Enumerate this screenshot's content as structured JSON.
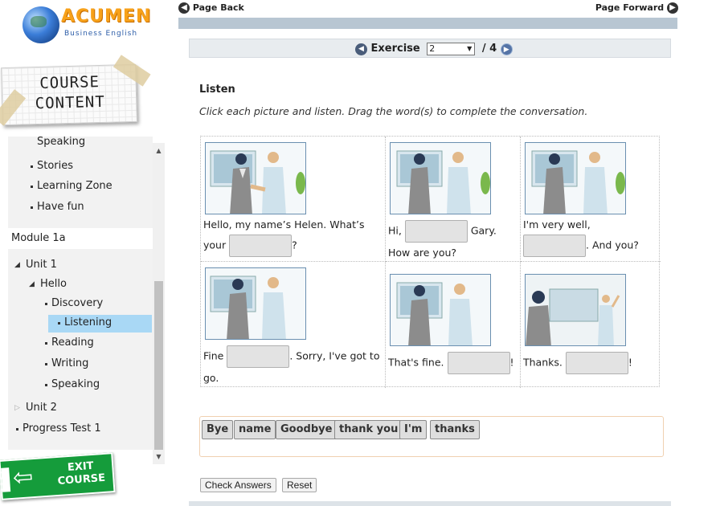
{
  "brand": {
    "name": "ACUMEN",
    "subtitle": "Business English"
  },
  "sidebar": {
    "card_title_line1": "COURSE",
    "card_title_line2": "CONTENT",
    "tree": [
      {
        "label": "Speaking"
      },
      {
        "label": "Stories"
      },
      {
        "label": "Learning Zone"
      },
      {
        "label": "Have fun"
      },
      {
        "label": "Module 1a"
      },
      {
        "label": "Unit 1"
      },
      {
        "label": "Hello"
      },
      {
        "label": "Discovery"
      },
      {
        "label": "Listening",
        "selected": true
      },
      {
        "label": "Reading"
      },
      {
        "label": "Writing"
      },
      {
        "label": "Speaking"
      },
      {
        "label": "Unit 2"
      },
      {
        "label": "Progress Test 1"
      }
    ],
    "exit_line1": "EXIT",
    "exit_line2": "COURSE"
  },
  "topnav": {
    "back_label": "Page Back",
    "forward_label": "Page Forward"
  },
  "exercise": {
    "label": "Exercise",
    "current": "2",
    "total_text": "/ 4"
  },
  "activity": {
    "title": "Listen",
    "instructions": "Click each picture and listen. Drag the word(s) to complete the conversation."
  },
  "cells": [
    {
      "before": "Hello, my name’s Helen. What’s your",
      "after": "?"
    },
    {
      "before": "Hi,",
      "after": "Gary. How are you?"
    },
    {
      "before": "I'm very well,",
      "after": ". And you?"
    },
    {
      "before": "Fine",
      "after": ". Sorry, I've got to go."
    },
    {
      "before": "That's fine.",
      "after": "!"
    },
    {
      "before": "Thanks.",
      "after": "!"
    }
  ],
  "word_bank": [
    "Bye",
    "name",
    "Goodbye",
    "thank you",
    "I'm",
    "thanks"
  ],
  "buttons": {
    "check": "Check Answers",
    "reset": "Reset"
  },
  "colors": {
    "accent_band": "#b8c6d2",
    "selected_item": "#a9d8f5",
    "exit_green": "#159c3b",
    "logo_orange": "#f7a11a"
  }
}
